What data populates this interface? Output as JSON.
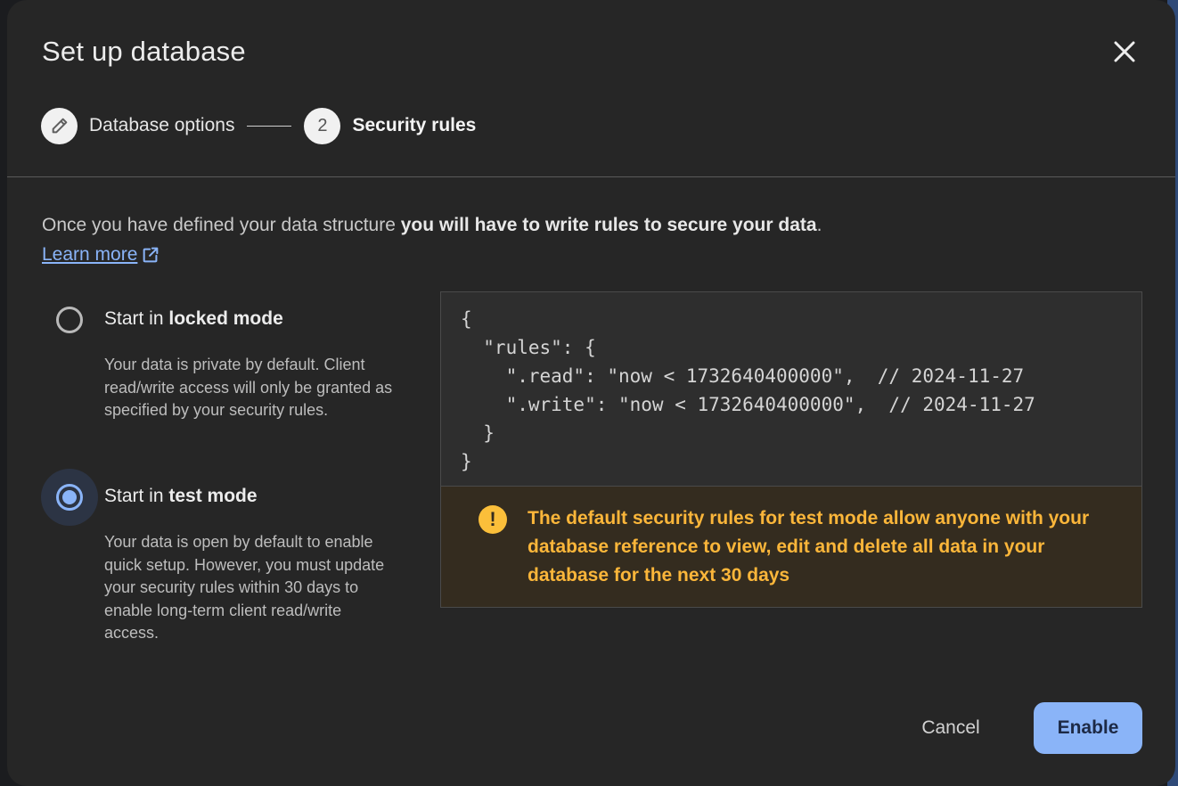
{
  "dialog": {
    "title": "Set up database",
    "close_icon": "close-icon"
  },
  "stepper": {
    "steps": [
      {
        "label": "Database options",
        "icon": "pencil-icon",
        "state": "completed"
      },
      {
        "label": "Security rules",
        "number": "2",
        "state": "active"
      }
    ]
  },
  "intro": {
    "text_before": "Once you have defined your data structure ",
    "text_bold": "you will have to write rules to secure your data",
    "text_after": ".",
    "learn_more": "Learn more",
    "learn_more_icon": "external-link-icon"
  },
  "options": [
    {
      "title_prefix": "Start in ",
      "title_bold": "locked mode",
      "description": "Your data is private by default. Client read/write access will only be granted as specified by your security rules.",
      "selected": false
    },
    {
      "title_prefix": "Start in ",
      "title_bold": "test mode",
      "description": "Your data is open by default to enable quick setup. However, you must update your security rules within 30 days to enable long-term client read/write access.",
      "selected": true
    }
  ],
  "code": {
    "lines": [
      "{",
      "  \"rules\": {",
      "    \".read\": \"now < 1732640400000\",  // 2024-11-27",
      "    \".write\": \"now < 1732640400000\",  // 2024-11-27",
      "  }",
      "}"
    ]
  },
  "warning": {
    "icon": "warning-icon",
    "text": "The default security rules for test mode allow anyone with your database reference to view, edit and delete all data in your database for the next 30 days"
  },
  "actions": {
    "cancel_label": "Cancel",
    "enable_label": "Enable"
  },
  "colors": {
    "accent": "#8ab4f8",
    "warning": "#fbb63a",
    "dialog_bg": "#262626"
  }
}
